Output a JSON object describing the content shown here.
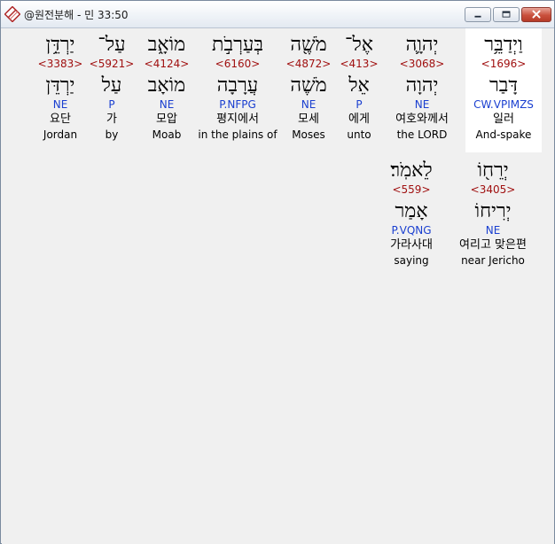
{
  "window": {
    "title": "@원전분해 - 민 33:50"
  },
  "verse": {
    "rows": [
      {
        "words": [
          {
            "surface": "יַרְדֵּ֥ן",
            "strong": "<3383>",
            "lemma": "יַרְדֵּן",
            "morph": "NE",
            "korean": "요단",
            "english": "Jordan"
          },
          {
            "surface": "עַל־",
            "strong": "<5921>",
            "lemma": "עַל",
            "morph": "P",
            "korean": "가",
            "english": "by"
          },
          {
            "surface": "מוֹאָ֑ב",
            "strong": "<4124>",
            "lemma": "מוֹאָב",
            "morph": "NE",
            "korean": "모압",
            "english": "Moab"
          },
          {
            "surface": "בְּעַרְבֹ֣ת",
            "strong": "<6160>",
            "lemma": "עֲרָבָה",
            "morph": "P.NFPG",
            "korean": "평지에서",
            "english": "in the plains of"
          },
          {
            "surface": "מֹשֶׁ֖ה",
            "strong": "<4872>",
            "lemma": "מֹשֶׁה",
            "morph": "NE",
            "korean": "모세",
            "english": "Moses"
          },
          {
            "surface": "אֶל־",
            "strong": "<413>",
            "lemma": "אֵל",
            "morph": "P",
            "korean": "에게",
            "english": "unto"
          },
          {
            "surface": "יְהוָ֛ה",
            "strong": "<3068>",
            "lemma": "יְהוָה",
            "morph": "NE",
            "korean": "여호와께서",
            "english": "the LORD"
          },
          {
            "surface": "וַיְדַבֵּ֥ר",
            "strong": "<1696>",
            "lemma": "דָּבַר",
            "morph": "CW.VPIMZS",
            "korean": "일러",
            "english": "And-spake"
          }
        ]
      },
      {
        "words": [
          {
            "surface": "לֵאמֹֽר׃",
            "strong": "<559>",
            "lemma": "אָמַר",
            "morph": "P.VQNG",
            "korean": "가라사대",
            "english": "saying"
          },
          {
            "surface": "יְרֵח֖וֹ",
            "strong": "<3405>",
            "lemma": "יְרִיחוֹ",
            "morph": "NE",
            "korean": "여리고 맞은편",
            "english": "near Jericho"
          }
        ]
      }
    ]
  },
  "colors": {
    "strong_number": "#a01010",
    "morphology": "#1a3fd0",
    "selected_background": "#ffffff"
  }
}
